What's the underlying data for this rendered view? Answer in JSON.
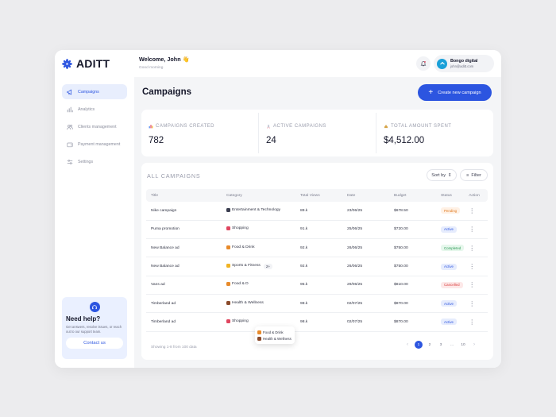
{
  "brand": {
    "name": "ADITT",
    "accent": "#2c55e0"
  },
  "sidebar": {
    "items": [
      {
        "label": "Campaigns",
        "icon": "megaphone-icon",
        "active": true
      },
      {
        "label": "Analytics",
        "icon": "bar-chart-icon",
        "active": false
      },
      {
        "label": "Clients management",
        "icon": "users-icon",
        "active": false
      },
      {
        "label": "Payment management",
        "icon": "wallet-icon",
        "active": false
      },
      {
        "label": "Settings",
        "icon": "sliders-icon",
        "active": false
      }
    ],
    "help": {
      "title": "Need help?",
      "text": "Get answers, resolve issues, or reach out to our support team.",
      "button": "Contact us"
    }
  },
  "header": {
    "welcome": "Welcome, John 👋",
    "greeting": "Good morning",
    "user": {
      "name": "Bongo digital",
      "email": "john@aditt.com"
    }
  },
  "page": {
    "title": "Campaigns",
    "create_button": "Create new campaign"
  },
  "stats": [
    {
      "label": "CAMPAIGNS CREATED",
      "value": "782",
      "icon": "bar-chart-icon"
    },
    {
      "label": "ACTIVE CAMPAIGNS",
      "value": "24",
      "icon": "rocket-icon"
    },
    {
      "label": "TOTAL AMOUNT SPENT",
      "value": "$4,512.00",
      "icon": "money-bag-icon"
    }
  ],
  "table": {
    "title": "ALL CAMPAIGNS",
    "sort_label": "Sort by",
    "filter_label": "Filter",
    "columns": [
      "Title",
      "Category",
      "Total Views",
      "Date",
      "Budget",
      "Status",
      "Action"
    ],
    "rows": [
      {
        "title": "Nike campaign",
        "category": "Entertainment & Technology",
        "cat_color": "#3b3e50",
        "views": "89.k",
        "date": "23/06/25",
        "budget": "$678.50",
        "status": "Pending",
        "status_class": "st-pending"
      },
      {
        "title": "Puma promotion",
        "category": "Shopping",
        "cat_color": "#e0455f",
        "views": "91.k",
        "date": "25/06/25",
        "budget": "$720.00",
        "status": "Active",
        "status_class": "st-active"
      },
      {
        "title": "New Balance ad",
        "category": "Food & Drink",
        "cat_color": "#e88a2a",
        "views": "92.k",
        "date": "26/06/25",
        "budget": "$750.00",
        "status": "Completed",
        "status_class": "st-completed"
      },
      {
        "title": "New Balance ad",
        "category": "Sports & Fitness",
        "cat_color": "#f0b323",
        "views": "92.k",
        "date": "26/06/25",
        "budget": "$750.00",
        "status": "Active",
        "status_class": "st-active",
        "more": "2+"
      },
      {
        "title": "Vans ad",
        "category": "Food & D",
        "cat_color": "#e88a2a",
        "views": "95.k",
        "date": "29/06/25",
        "budget": "$810.00",
        "status": "Cancelled",
        "status_class": "st-cancelled"
      },
      {
        "title": "Timberland ad",
        "category": "Health & Wellness",
        "cat_color": "#8a4a2a",
        "views": "98.k",
        "date": "02/07/25",
        "budget": "$870.00",
        "status": "Active",
        "status_class": "st-active"
      },
      {
        "title": "Timberland ad",
        "category": "Shopping",
        "cat_color": "#e0455f",
        "views": "98.k",
        "date": "02/07/25",
        "budget": "$870.00",
        "status": "Active",
        "status_class": "st-active"
      }
    ],
    "popover": [
      "Food & Drink",
      "Health & Wellness"
    ],
    "footer_info": "Showing 1-8 from 100 data",
    "pages": [
      "1",
      "2",
      "3",
      "...",
      "10"
    ],
    "current_page": "1"
  }
}
